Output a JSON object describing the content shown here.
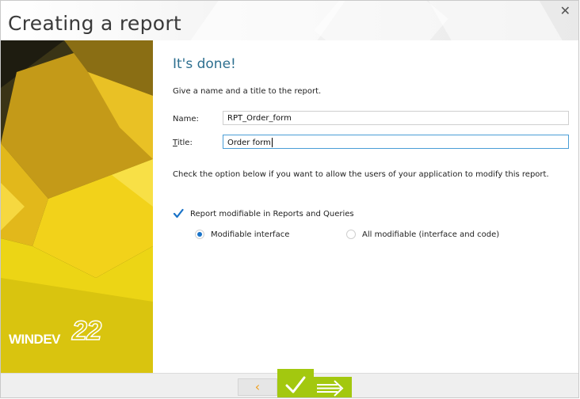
{
  "window": {
    "title": "Creating a report",
    "close_glyph": "✕"
  },
  "sidebar": {
    "logo_text": "WINDEV",
    "logo_version": "22"
  },
  "content": {
    "heading": "It's done!",
    "intro": "Give a name and a title to the report.",
    "name_label": "Name:",
    "name_value": "RPT_Order_form",
    "title_label_first": "T",
    "title_label_rest": "itle:",
    "title_value": "Order form",
    "description": "Check the option below if you want to allow the users of your application to modify this report.",
    "checkbox_label": "Report modifiable in Reports and Queries",
    "checkbox_checked": true,
    "radio_options": [
      {
        "label": "Modifiable interface",
        "selected": true
      },
      {
        "label": "All modifiable (interface and code)",
        "selected": false
      }
    ]
  },
  "footer": {
    "prev_glyph": "‹",
    "icons": {
      "prev": "chevron-left-icon",
      "finish": "checkmark-icon",
      "next": "arrow-right-icon"
    }
  },
  "colors": {
    "accent_green": "#a3c80f",
    "heading_blue": "#2d6f8f",
    "check_blue": "#1a73c8",
    "chevron_orange": "#f0a01e",
    "sidebar_yellow": "#f2d21a"
  }
}
